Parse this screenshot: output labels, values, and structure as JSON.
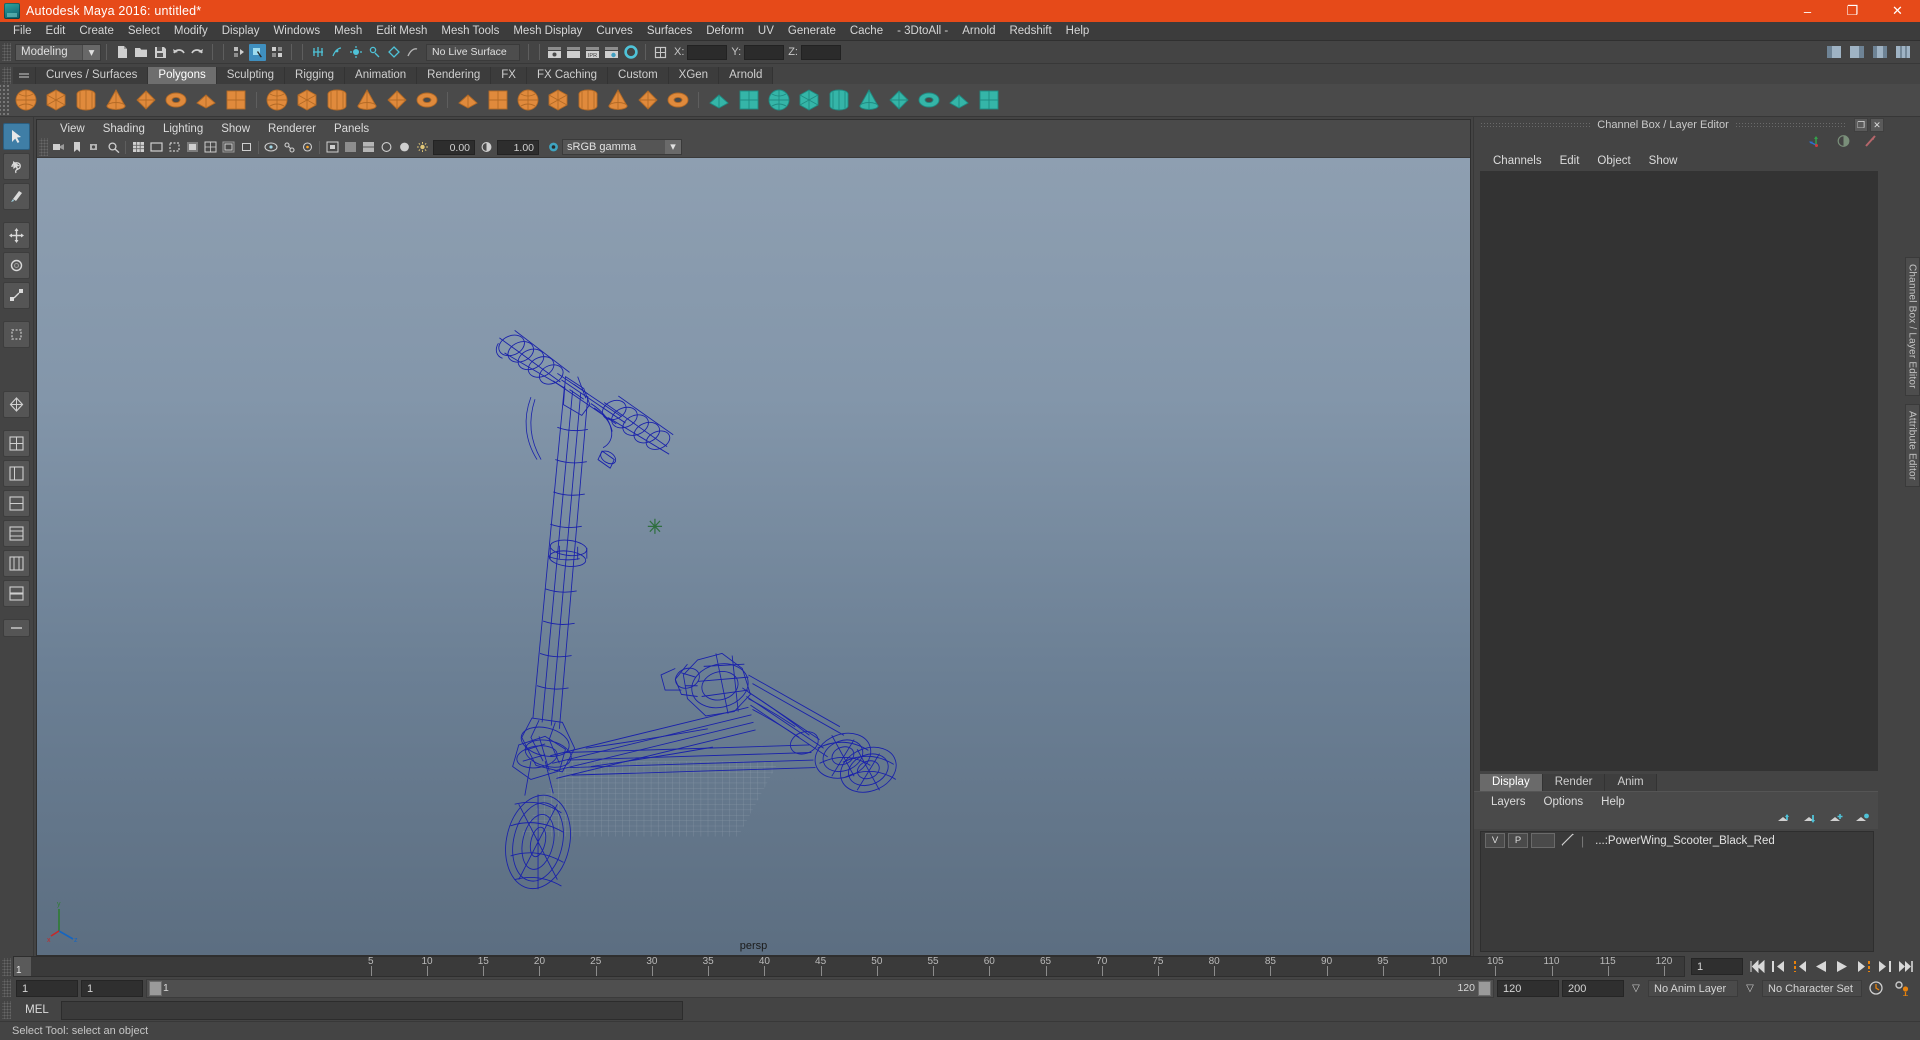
{
  "window": {
    "title": "Autodesk Maya 2016: untitled*",
    "minimize": "–",
    "maximize": "❐",
    "close": "✕"
  },
  "menubar": {
    "items": [
      "File",
      "Edit",
      "Create",
      "Select",
      "Modify",
      "Display",
      "Windows",
      "Mesh",
      "Edit Mesh",
      "Mesh Tools",
      "Mesh Display",
      "Curves",
      "Surfaces",
      "Deform",
      "UV",
      "Generate",
      "Cache",
      "- 3DtoAll -",
      "Arnold",
      "Redshift",
      "Help"
    ]
  },
  "statusline": {
    "menuset": "Modeling",
    "menuset_arrow": "▾",
    "live_surface": "No Live Surface",
    "coord_labels": [
      "X:",
      "Y:",
      "Z:"
    ],
    "coord_values": [
      "",
      "",
      ""
    ],
    "icons": [
      "new-scene-icon",
      "open-scene-icon",
      "save-scene-icon",
      "undo-icon",
      "redo-icon",
      "select-hierarchy-icon",
      "select-object-icon",
      "select-component-icon",
      "snap-grid-icon",
      "snap-curve-icon",
      "snap-point-icon",
      "snap-projected-icon",
      "snap-view-plane-icon",
      "make-live-icon",
      "render-view-icon",
      "render-frame-icon",
      "ipr-render-icon",
      "render-settings-icon",
      "hypershade-icon",
      "show-manipulator-icon"
    ]
  },
  "shelf": {
    "tabs": [
      "Curves / Surfaces",
      "Polygons",
      "Sculpting",
      "Rigging",
      "Animation",
      "Rendering",
      "FX",
      "FX Caching",
      "Custom",
      "XGen",
      "Arnold"
    ],
    "active_tab": "Polygons",
    "icon_names": [
      "poly-sphere",
      "poly-cube",
      "poly-cylinder",
      "poly-cone",
      "poly-torus",
      "poly-plane",
      "poly-disc",
      "poly-platonic",
      "poly-combine",
      "poly-separate",
      "poly-extract",
      "poly-booleans",
      "poly-mirror",
      "poly-smooth",
      "poly-extrude",
      "poly-bevel",
      "poly-bridge",
      "poly-append",
      "poly-wedge",
      "poly-fill-hole",
      "poly-reduce",
      "poly-remesh",
      "poly-retopo",
      "poly-sculpt",
      "poly-uv-editor",
      "poly-uv-layout",
      "poly-planar-map",
      "poly-cylindrical-map",
      "poly-spherical-map",
      "poly-automatic-map",
      "poly-crease",
      "poly-cut-faces"
    ]
  },
  "toolbox": {
    "tools": [
      "select-tool",
      "lasso-select-tool",
      "paint-select-tool",
      "move-tool",
      "rotate-tool",
      "scale-tool",
      "last-tool",
      "quick-layout-single",
      "quick-layout-four",
      "quick-layout-persp-outliner",
      "quick-layout-persp-graph",
      "quick-layout-hypershade",
      "quick-layout-outliner",
      "quick-layout-extra",
      "quick-layout-more"
    ],
    "active": "select-tool"
  },
  "viewport": {
    "panel_menus": [
      "View",
      "Shading",
      "Lighting",
      "Show",
      "Renderer",
      "Panels"
    ],
    "camera_label": "persp",
    "exposure": "0.00",
    "gamma": "1.00",
    "color_management": "sRGB gamma",
    "cm_arrow": "▾",
    "toolbar_icons": [
      "select-camera-icon",
      "bookmark-icon",
      "camera-attributes-icon",
      "image-plane-icon",
      "two-d-pan-zoom-icon",
      "grid-icon",
      "film-gate-icon",
      "resolution-gate-icon",
      "gate-mask-icon",
      "field-chart-icon",
      "safe-action-icon",
      "safe-title-icon",
      "xray-icon",
      "xray-joints-icon",
      "xray-active-components-icon",
      "exposure-icon",
      "gamma-icon",
      "isolate-select-icon",
      "wireframe-icon",
      "smooth-shade-icon",
      "shaded-textured-icon",
      "use-all-lights-icon",
      "shadows-icon",
      "screen-space-ao-icon",
      "motion-blur-icon",
      "multisample-icon",
      "depth-peeling-icon",
      "viewport-settings-icon"
    ],
    "model_name": "PowerWing Scooter wireframe",
    "wire_color": "#1a22aa"
  },
  "right_panel": {
    "title": "Channel Box / Layer Editor",
    "undock_glyph": "❐",
    "close_glyph": "✕",
    "menus": [
      "Channels",
      "Edit",
      "Object",
      "Show"
    ],
    "header_icons": [
      "channel-box-icon",
      "attribute-editor-icon",
      "tool-settings-icon"
    ],
    "vertical_tabs": [
      "Channel Box / Layer Editor",
      "Attribute Editor"
    ]
  },
  "layer_editor": {
    "tabs": [
      "Display",
      "Render",
      "Anim"
    ],
    "active_tab": "Display",
    "menus": [
      "Layers",
      "Options",
      "Help"
    ],
    "buttons": [
      "move-layer-up-icon",
      "move-layer-down-icon",
      "new-layer-icon",
      "new-layer-from-selected-icon"
    ],
    "layers": [
      {
        "visibility": "V",
        "playback": "P",
        "shading": "",
        "name": "...:PowerWing_Scooter_Black_Red"
      }
    ]
  },
  "timeline": {
    "start_display": "1",
    "ticks": [
      5,
      10,
      15,
      20,
      25,
      30,
      35,
      40,
      45,
      50,
      55,
      60,
      65,
      70,
      75,
      80,
      85,
      90,
      95,
      100,
      105,
      110,
      115,
      120
    ],
    "current_frame": "1",
    "playback_buttons": [
      "go-to-start-icon",
      "step-back-frame-icon",
      "step-back-key-icon",
      "play-backwards-icon",
      "play-forwards-icon",
      "step-forward-key-icon",
      "step-forward-frame-icon",
      "go-to-end-icon"
    ]
  },
  "range": {
    "anim_start": "1",
    "range_start": "1",
    "bar_start_label": "1",
    "bar_end_label": "120",
    "range_end": "120",
    "anim_end": "200",
    "anim_layer": "No Anim Layer",
    "anim_layer_arrow": "▽",
    "character_set": "No Character Set",
    "char_arrow": "▽",
    "right_icons": [
      "auto-key-icon",
      "animation-preferences-icon"
    ]
  },
  "mel": {
    "label": "MEL",
    "command": "",
    "result": ""
  },
  "statusbar": {
    "message": "Select Tool: select an object"
  },
  "colors": {
    "title_bar": "#e64a19",
    "accent": "#3f8fbf",
    "panel_bg": "#444444",
    "field_bg": "#2f2f2f",
    "shelf_icon": "#e08a3c",
    "wire_blue": "#1a22aa"
  }
}
